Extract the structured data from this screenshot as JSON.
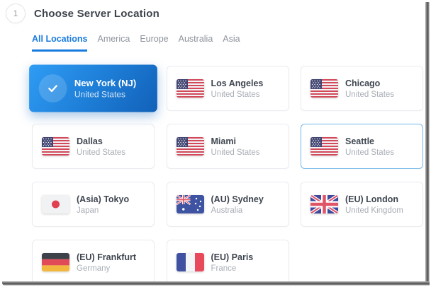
{
  "colors": {
    "accent": "#197be0",
    "selected_gradient_start": "#2f9cf4",
    "selected_gradient_end": "#1261b8",
    "highlight_border": "#74b7ea"
  },
  "step": {
    "number": "1",
    "title": "Choose Server Location"
  },
  "tabs": [
    {
      "label": "All Locations",
      "active": true
    },
    {
      "label": "America",
      "active": false
    },
    {
      "label": "Europe",
      "active": false
    },
    {
      "label": "Australia",
      "active": false
    },
    {
      "label": "Asia",
      "active": false
    }
  ],
  "icons": {
    "selected_check": "check-icon",
    "flags": [
      "us-flag-icon",
      "japan-flag-icon",
      "australia-flag-icon",
      "uk-flag-icon",
      "germany-flag-icon",
      "france-flag-icon"
    ]
  },
  "cards": [
    {
      "name": "New York (NJ)",
      "country": "United States",
      "flag": "us",
      "selected": true
    },
    {
      "name": "Los Angeles",
      "country": "United States",
      "flag": "us",
      "selected": false
    },
    {
      "name": "Chicago",
      "country": "United States",
      "flag": "us",
      "selected": false
    },
    {
      "name": "Dallas",
      "country": "United States",
      "flag": "us",
      "selected": false
    },
    {
      "name": "Miami",
      "country": "United States",
      "flag": "us",
      "selected": false
    },
    {
      "name": "Seattle",
      "country": "United States",
      "flag": "us",
      "selected": false,
      "highlighted": true
    },
    {
      "name": "(Asia) Tokyo",
      "country": "Japan",
      "flag": "jp",
      "selected": false
    },
    {
      "name": "(AU) Sydney",
      "country": "Australia",
      "flag": "au",
      "selected": false
    },
    {
      "name": "(EU) London",
      "country": "United Kingdom",
      "flag": "gb",
      "selected": false
    },
    {
      "name": "(EU) Frankfurt",
      "country": "Germany",
      "flag": "de",
      "selected": false
    },
    {
      "name": "(EU) Paris",
      "country": "France",
      "flag": "fr",
      "selected": false
    }
  ]
}
